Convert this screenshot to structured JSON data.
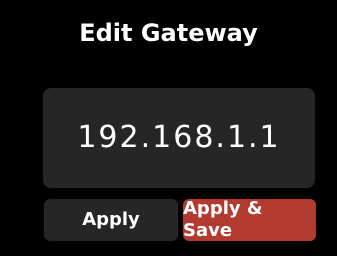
{
  "screen": {
    "title": "Edit Gateway",
    "gateway_value": "192.168.1.1",
    "buttons": {
      "apply_label": "Apply",
      "apply_save_label": "Apply & Save"
    }
  },
  "colors": {
    "background": "#000000",
    "panel": "#262626",
    "accent_red": "#b23a2f",
    "text": "#ffffff"
  }
}
